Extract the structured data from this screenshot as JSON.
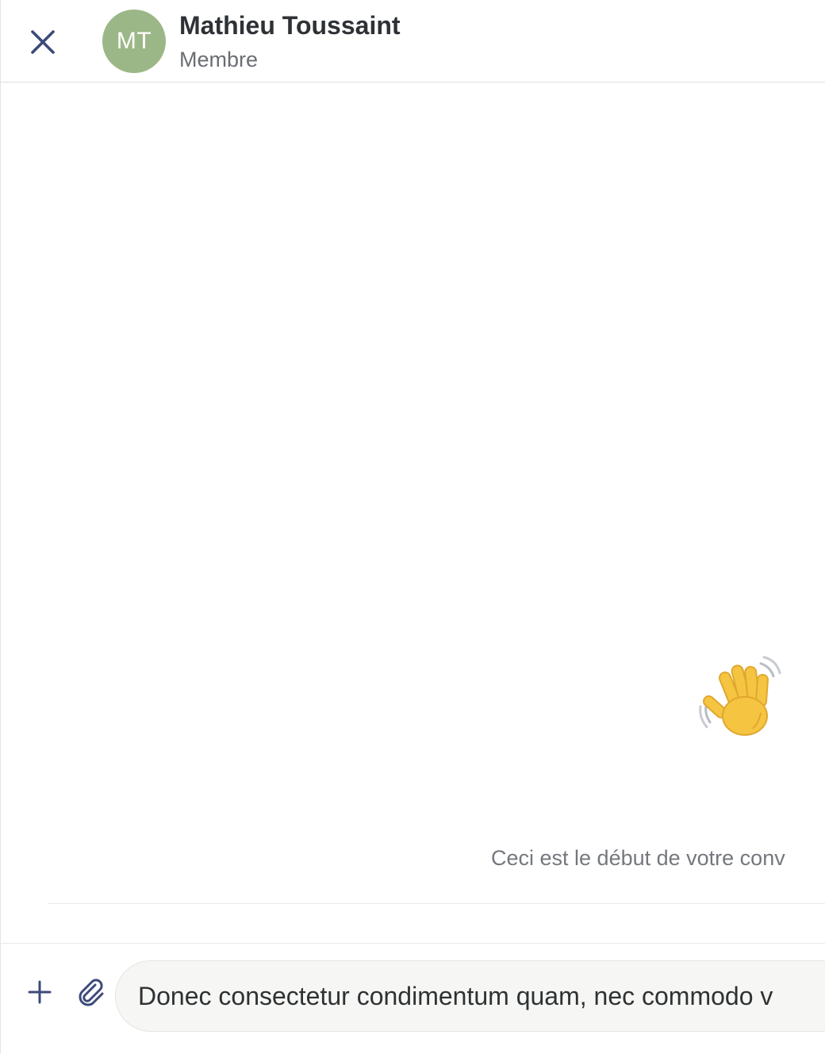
{
  "header": {
    "close_icon": "close-icon",
    "avatar_initials": "MT",
    "avatar_color": "#9cb787",
    "contact_name": "Mathieu Toussaint",
    "contact_role": "Membre"
  },
  "conversation": {
    "wave_icon": "waving-hand-icon",
    "start_text": "Ceci est le début de votre conv"
  },
  "composer": {
    "add_icon": "plus-icon",
    "attach_icon": "paperclip-icon",
    "message_value": "Donec consectetur condimentum quam, nec commodo v"
  },
  "colors": {
    "icon": "#3d4a7a",
    "wave_fill": "#f5c542"
  }
}
